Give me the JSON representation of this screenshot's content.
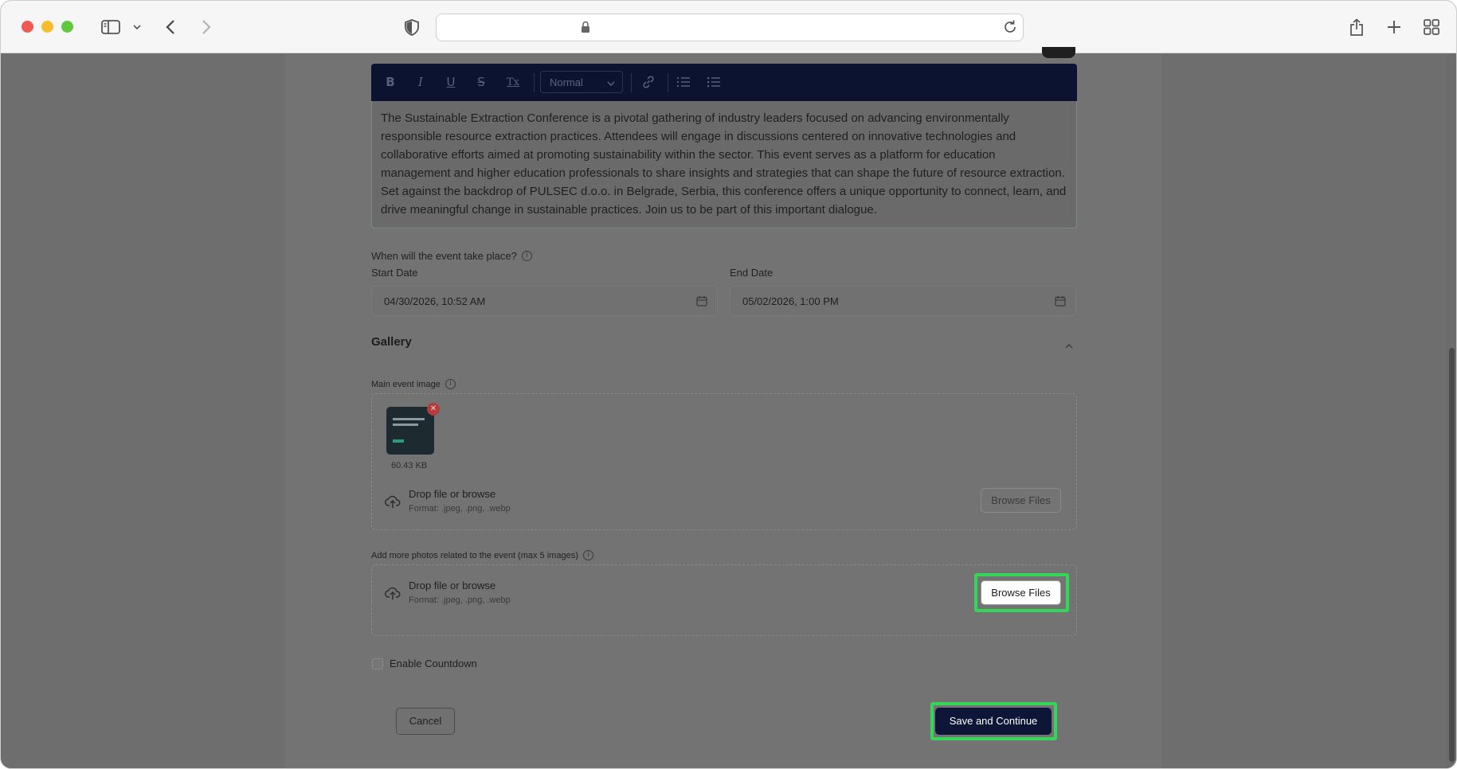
{
  "browser": {
    "icons": {
      "sidebar": "sidebar-icon",
      "back": "chevron-left-icon",
      "forward": "chevron-right-icon",
      "shield": "shield-icon",
      "lock": "lock-icon",
      "reload": "reload-icon",
      "share": "share-icon",
      "new_tab": "plus-icon",
      "tabs": "grid-icon"
    }
  },
  "editor": {
    "toolbar": {
      "bold": "B",
      "italic": "I",
      "underline": "U",
      "strike": "S",
      "clear_format": "Tx",
      "format_select": "Normal"
    },
    "content": "The Sustainable Extraction Conference is a pivotal gathering of industry leaders focused on advancing environmentally responsible resource extraction practices. Attendees will engage in discussions centered on innovative technologies and collaborative efforts aimed at promoting sustainability within the sector. This event serves as a platform for education management and higher education professionals to share insights and strategies that can shape the future of resource extraction. Set against the backdrop of PULSEC d.o.o. in Belgrade, Serbia, this conference offers a unique opportunity to connect, learn, and drive meaningful change in sustainable practices. Join us to be part of this important dialogue."
  },
  "dates": {
    "question": "When will the event take place?",
    "start_label": "Start Date",
    "start_value": "04/30/2026, 10:52 AM",
    "end_label": "End Date",
    "end_value": "05/02/2026, 1:00 PM"
  },
  "gallery": {
    "title": "Gallery",
    "main_image": {
      "label": "Main event image",
      "file_size": "60.43 KB",
      "drop_title": "Drop file or browse",
      "drop_format": "Format: .jpeg, .png, .webp",
      "browse_label": "Browse Files"
    },
    "more_photos": {
      "label": "Add more photos related to the event (max 5 images)",
      "drop_title": "Drop file or browse",
      "drop_format": "Format: .jpeg, .png, .webp",
      "browse_label": "Browse Files"
    }
  },
  "countdown": {
    "label": "Enable Countdown",
    "checked": false
  },
  "actions": {
    "cancel": "Cancel",
    "save": "Save and Continue"
  },
  "colors": {
    "highlight": "#34d65a",
    "toolbar_bg": "#0c1330",
    "primary_button": "#0e1638"
  }
}
